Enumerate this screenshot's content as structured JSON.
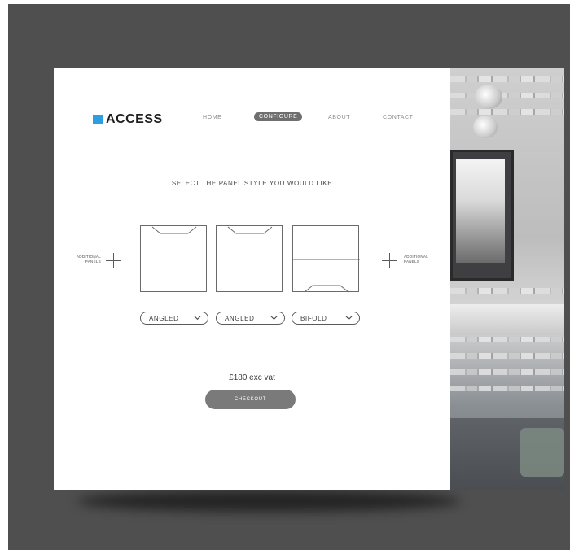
{
  "brand": {
    "name": "ACCESS",
    "accent": "#2d9fe0"
  },
  "nav": {
    "items": [
      "HOME",
      "CONFIGURE",
      "ABOUT",
      "CONTACT"
    ],
    "active": "CONFIGURE"
  },
  "prompt": "SELECT THE PANEL STYLE YOU WOULD LIKE",
  "additional_panels": {
    "line1": "ADDITIONAL",
    "line2": "PANELS"
  },
  "panels": [
    {
      "style": "ANGLED",
      "icon": "angled-panel-icon"
    },
    {
      "style": "ANGLED",
      "icon": "angled-panel-icon"
    },
    {
      "style": "BIFOLD",
      "icon": "bifold-panel-icon"
    }
  ],
  "price": "£180 exc vat",
  "checkout_label": "CHECKOUT",
  "colors": {
    "backdrop": "#4f4f4f",
    "button": "#7a7a7a",
    "active_nav": "#6f6f6f"
  }
}
